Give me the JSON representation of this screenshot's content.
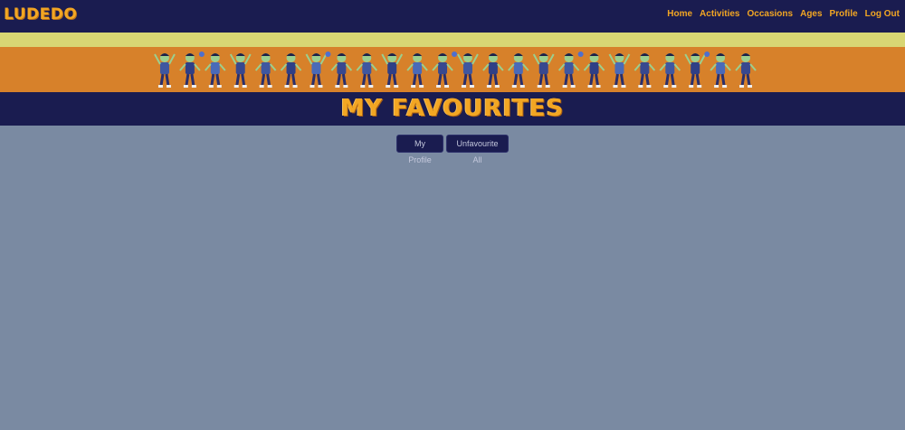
{
  "nav": {
    "brand": "LUDEDO",
    "links": [
      "Home",
      "Activities",
      "Occasions",
      "Ages",
      "Profile",
      "Log Out"
    ]
  },
  "page": {
    "title": "MY FAVOURITES"
  },
  "buttons": {
    "my_profile": "My Profile",
    "unfavourite_all": "Unfavourite All"
  },
  "colors": {
    "navy": "#1a1c50",
    "orange": "#d7812a",
    "gold_text": "#f2a623",
    "pale_yellow": "#d8d673",
    "content_bg": "#7a8aa2"
  }
}
